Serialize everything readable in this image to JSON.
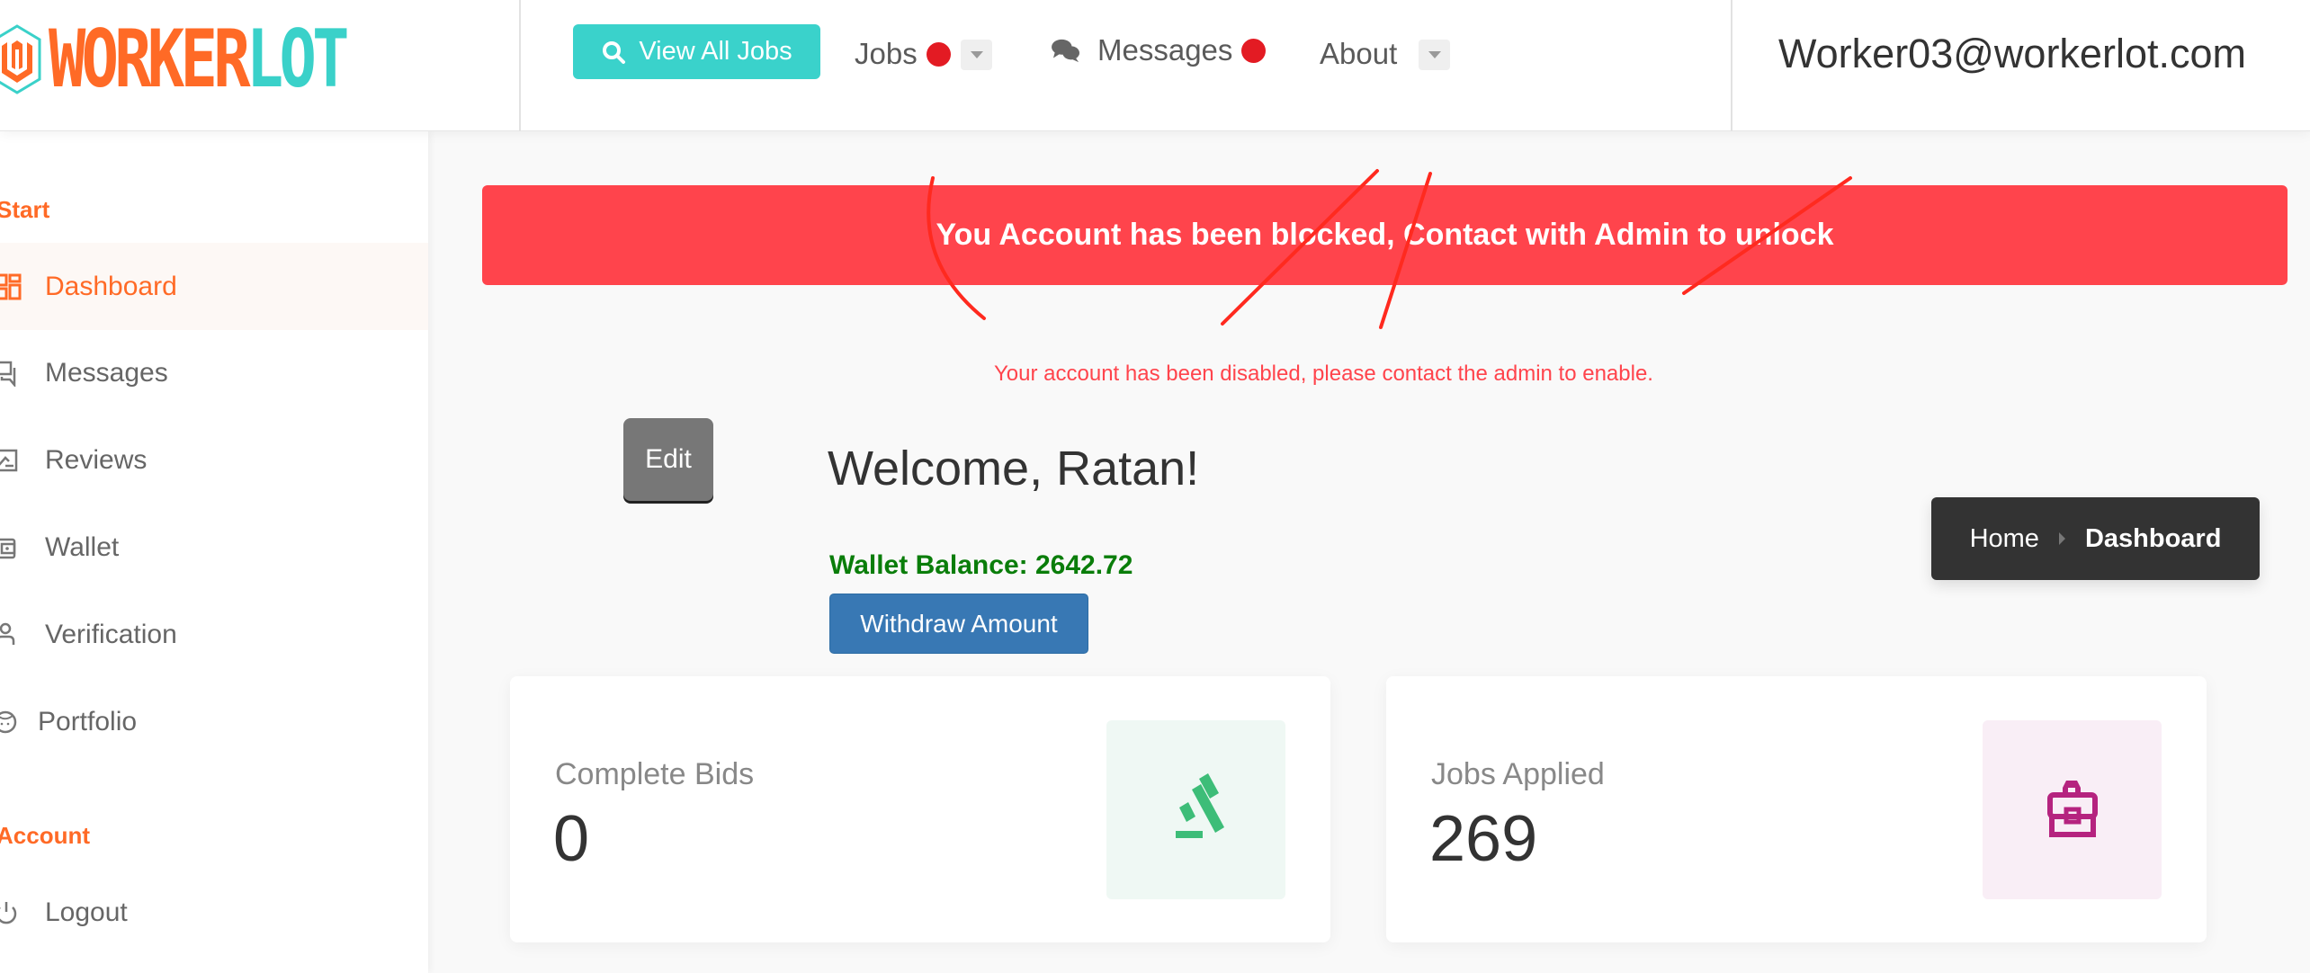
{
  "header": {
    "logo": {
      "part1": "WORKER",
      "part2": "LOT"
    },
    "view_all_jobs_label": "View All Jobs",
    "nav": [
      {
        "label": "Jobs",
        "has_notification": true,
        "has_dropdown": true
      },
      {
        "label": "Messages",
        "has_notification": true,
        "has_dropdown": false
      },
      {
        "label": "About",
        "has_notification": false,
        "has_dropdown": true
      }
    ],
    "user_email": "Worker03@workerlot.com"
  },
  "sidebar": {
    "sections": [
      {
        "label": "Start",
        "items": [
          {
            "label": "Dashboard",
            "icon": "dashboard-grid-icon",
            "active": true
          },
          {
            "label": "Messages",
            "icon": "chat-icon",
            "active": false
          },
          {
            "label": "Reviews",
            "icon": "review-image-icon",
            "active": false
          },
          {
            "label": "Wallet",
            "icon": "wallet-icon",
            "active": false
          },
          {
            "label": "Verification",
            "icon": "user-icon",
            "active": false
          },
          {
            "label": "Portfolio",
            "icon": "face-icon",
            "active": false
          }
        ]
      },
      {
        "label": "Account",
        "items": [
          {
            "label": "Logout",
            "icon": "power-icon",
            "active": false
          }
        ]
      }
    ]
  },
  "main": {
    "blocked_banner": "You Account has been blocked, Contact with Admin to unlock",
    "disabled_message": "Your account has been disabled, please contact the admin to enable.",
    "edit_label": "Edit",
    "welcome": "Welcome, Ratan!",
    "wallet_balance_label": "Wallet Balance: 2642.72",
    "wallet_balance_value": 2642.72,
    "withdraw_label": "Withdraw Amount",
    "breadcrumb": {
      "home": "Home",
      "current": "Dashboard"
    },
    "cards": [
      {
        "label": "Complete Bids",
        "value": "0",
        "icon": "gavel-icon"
      },
      {
        "label": "Jobs Applied",
        "value": "269",
        "icon": "briefcase-icon"
      }
    ]
  },
  "colors": {
    "brand_orange": "#ff6a26",
    "brand_teal": "#3ad2cb",
    "alert_red": "#ff444c",
    "notification_red": "#e31b23",
    "balance_green": "#0a7d0a",
    "withdraw_blue": "#3878b4",
    "bids_green": "#3dbd78",
    "jobs_magenta": "#b5237f"
  }
}
